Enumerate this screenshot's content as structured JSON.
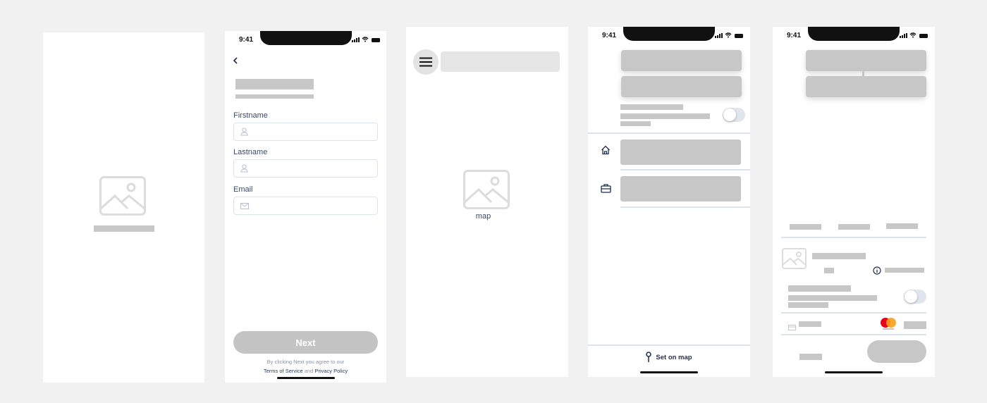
{
  "status_bar": {
    "time": "9:41"
  },
  "screen2": {
    "fields": [
      {
        "label": "Firstname",
        "icon": "user-icon"
      },
      {
        "label": "Lastname",
        "icon": "user-icon"
      },
      {
        "label": "Email",
        "icon": "mail-icon"
      }
    ],
    "next_label": "Next",
    "terms_prefix": "By clicking Next you agree to our",
    "terms_link": "Terms of Service",
    "terms_and": "and",
    "privacy_link": "Privacy Policy"
  },
  "screen3": {
    "map_label": "map"
  },
  "screen4": {
    "set_on_map": "Set on map"
  },
  "colors": {
    "placeholder": "#c7c7c7",
    "text_dark": "#1f2d4d",
    "background": "#f1f1f1",
    "mastercard_red": "#eb001b",
    "mastercard_orange": "#f79e1b"
  }
}
